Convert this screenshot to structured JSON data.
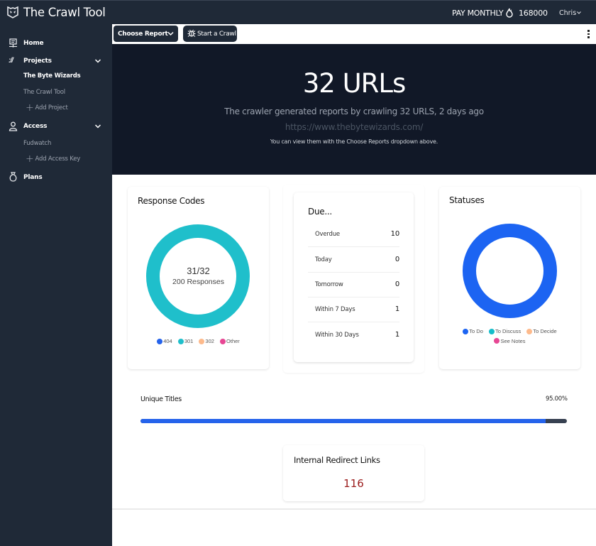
{
  "header": {
    "app_title": "The Crawl Tool",
    "plan_label": "PAY MONTHLY",
    "credits": "168000",
    "user_name": "Chris"
  },
  "sidebar": {
    "items": [
      {
        "label": "Home",
        "icon": "monitor-network-icon"
      },
      {
        "label": "Projects",
        "icon": "url-slashes-icon",
        "expanded": true,
        "children": [
          "The Byte Wizards",
          "The Crawl Tool"
        ],
        "add_label": "Add Project",
        "active_child": "The Byte Wizards"
      },
      {
        "label": "Access",
        "icon": "user-icon",
        "expanded": true,
        "children": [
          "Fudwatch"
        ],
        "add_label": "Add Access Key"
      },
      {
        "label": "Plans",
        "icon": "money-bag-icon"
      }
    ]
  },
  "toolbar": {
    "choose_report_label": "Choose Report",
    "start_crawl_label": "Start a Crawl"
  },
  "hero": {
    "title": "32 URLs",
    "subtitle": "The crawler generated reports by crawling 32 URLS, 2 days ago",
    "url": "https://www.thebytewizards.com/",
    "note": "You can view them with the Choose Reports dropdown above."
  },
  "response_codes": {
    "title": "Response Codes",
    "center_main": "31/32",
    "center_sub": "200 Responses",
    "legend": [
      {
        "label": "404",
        "color": "#2563eb"
      },
      {
        "label": "301",
        "color": "#1fbfcb"
      },
      {
        "label": "302",
        "color": "#fdba8c"
      },
      {
        "label": "Other",
        "color": "#e74694"
      }
    ]
  },
  "due": {
    "title": "Due...",
    "rows": [
      {
        "label": "Overdue",
        "value": "10"
      },
      {
        "label": "Today",
        "value": "0"
      },
      {
        "label": "Tomorrow",
        "value": "0"
      },
      {
        "label": "Within 7 Days",
        "value": "1"
      },
      {
        "label": "Within 30 Days",
        "value": "1"
      }
    ]
  },
  "statuses": {
    "title": "Statuses",
    "legend": [
      {
        "label": "To Do",
        "color": "#1c64f2"
      },
      {
        "label": "To Discuss",
        "color": "#16bdca"
      },
      {
        "label": "To Decide",
        "color": "#fdba8c"
      },
      {
        "label": "See Notes",
        "color": "#e74694"
      }
    ]
  },
  "unique_titles": {
    "label": "Unique Titles",
    "percent_text": "95.00%",
    "value": 95.0
  },
  "internal_redirects": {
    "title": "Internal Redirect Links",
    "value": "116",
    "value_color": "#9b1c1c"
  },
  "chart_data": [
    {
      "type": "pie",
      "title": "Response Codes",
      "categories": [
        "404",
        "301",
        "302",
        "Other"
      ],
      "values": [
        0,
        32,
        0,
        0
      ],
      "colors": [
        "#2563eb",
        "#1fbfcb",
        "#fdba8c",
        "#e74694"
      ],
      "center_text": [
        "31/32",
        "200 Responses"
      ],
      "legend": "bottom"
    },
    {
      "type": "pie",
      "title": "Statuses",
      "categories": [
        "To Do",
        "To Discuss",
        "To Decide",
        "See Notes"
      ],
      "values": [
        1,
        0,
        0,
        0
      ],
      "colors": [
        "#1c64f2",
        "#16bdca",
        "#fdba8c",
        "#e74694"
      ],
      "legend": "bottom"
    }
  ]
}
